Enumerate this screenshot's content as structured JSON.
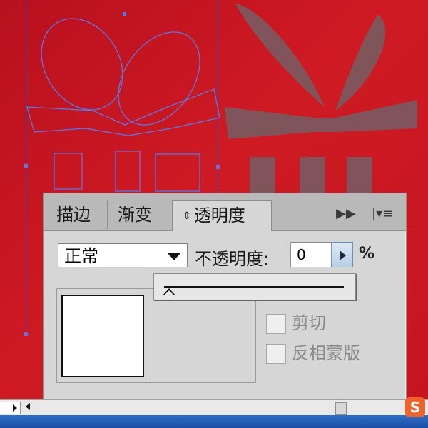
{
  "panel": {
    "tabs": [
      {
        "label": "描边",
        "active": false
      },
      {
        "label": "渐变",
        "active": false
      },
      {
        "label": "透明度",
        "active": true
      }
    ],
    "active_tab_arrow": "⇕",
    "blend_mode": "正常",
    "opacity_label": "不透明度:",
    "opacity_value": "0",
    "percent_sign": "%",
    "slider_value": 0,
    "clip_label": "剪切",
    "invert_mask_label": "反相蒙版",
    "clip_checked": false,
    "invert_mask_checked": false
  },
  "tray": {
    "ime_icon_letter": "S"
  },
  "colors": {
    "background_red": "#c41620",
    "selection_blue": "#5a78e6",
    "artwork_ghost": "#7a5a5f",
    "ime_orange": "#f0622b"
  }
}
